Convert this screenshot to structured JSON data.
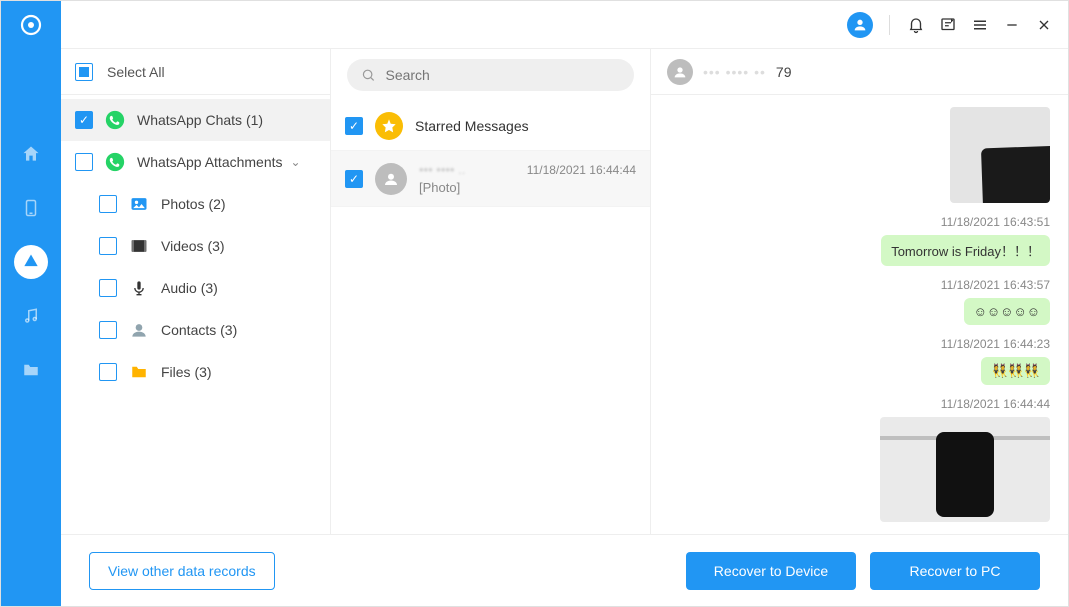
{
  "nav": {
    "items": [
      {
        "name": "home"
      },
      {
        "name": "phone"
      },
      {
        "name": "cloud",
        "active": true
      },
      {
        "name": "music"
      },
      {
        "name": "folder"
      }
    ]
  },
  "selectAll": {
    "label": "Select All",
    "state": "indeterminate"
  },
  "categories": {
    "chats": {
      "label": "WhatsApp Chats (1)",
      "checked": true
    },
    "attachments": {
      "label": "WhatsApp Attachments",
      "checked": false,
      "expanded": true,
      "children": [
        {
          "key": "photos",
          "label": "Photos (2)",
          "iconColor": "#2196f3"
        },
        {
          "key": "videos",
          "label": "Videos (3)",
          "iconColor": "#333"
        },
        {
          "key": "audio",
          "label": "Audio (3)",
          "iconColor": "#333"
        },
        {
          "key": "contacts",
          "label": "Contacts (3)",
          "iconColor": "#90a4ae"
        },
        {
          "key": "files",
          "label": "Files (3)",
          "iconColor": "#ffb300"
        }
      ]
    }
  },
  "search": {
    "placeholder": "Search"
  },
  "starred": {
    "label": "Starred Messages",
    "checked": true
  },
  "threads": [
    {
      "checked": true,
      "nameMasked": "••• •••• ..",
      "preview": "[Photo]",
      "timestamp": "11/18/2021 16:44:44"
    }
  ],
  "chat": {
    "header": {
      "nameSuffix": "79"
    },
    "messages": [
      {
        "type": "photo",
        "ts": "11/18/2021 16:43:51"
      },
      {
        "type": "text",
        "text": "Tomorrow is Friday！！！",
        "ts": "11/18/2021 16:43:57"
      },
      {
        "type": "text",
        "text": "☺☺☺☺☺",
        "ts": "11/18/2021 16:44:23"
      },
      {
        "type": "text",
        "text": "👯👯👯",
        "ts": "11/18/2021 16:44:44"
      },
      {
        "type": "photo-wide"
      }
    ]
  },
  "footer": {
    "viewOther": "View other data records",
    "recoverDevice": "Recover to Device",
    "recoverPC": "Recover to PC"
  }
}
